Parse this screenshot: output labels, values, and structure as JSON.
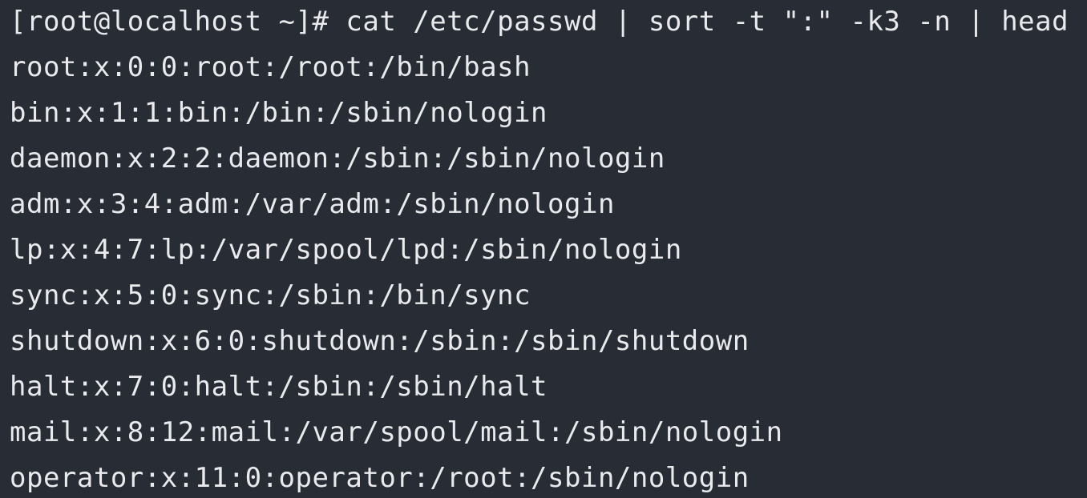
{
  "terminal": {
    "command_line": "[root@localhost ~]# cat /etc/passwd | sort -t \":\" -k3 -n | head",
    "output_lines": [
      "root:x:0:0:root:/root:/bin/bash",
      "bin:x:1:1:bin:/bin:/sbin/nologin",
      "daemon:x:2:2:daemon:/sbin:/sbin/nologin",
      "adm:x:3:4:adm:/var/adm:/sbin/nologin",
      "lp:x:4:7:lp:/var/spool/lpd:/sbin/nologin",
      "sync:x:5:0:sync:/sbin:/bin/sync",
      "shutdown:x:6:0:shutdown:/sbin:/sbin/shutdown",
      "halt:x:7:0:halt:/sbin:/sbin/halt",
      "mail:x:8:12:mail:/var/spool/mail:/sbin/nologin",
      "operator:x:11:0:operator:/root:/sbin/nologin"
    ]
  },
  "colors": {
    "background": "#282c34",
    "foreground": "#e8eaed"
  }
}
